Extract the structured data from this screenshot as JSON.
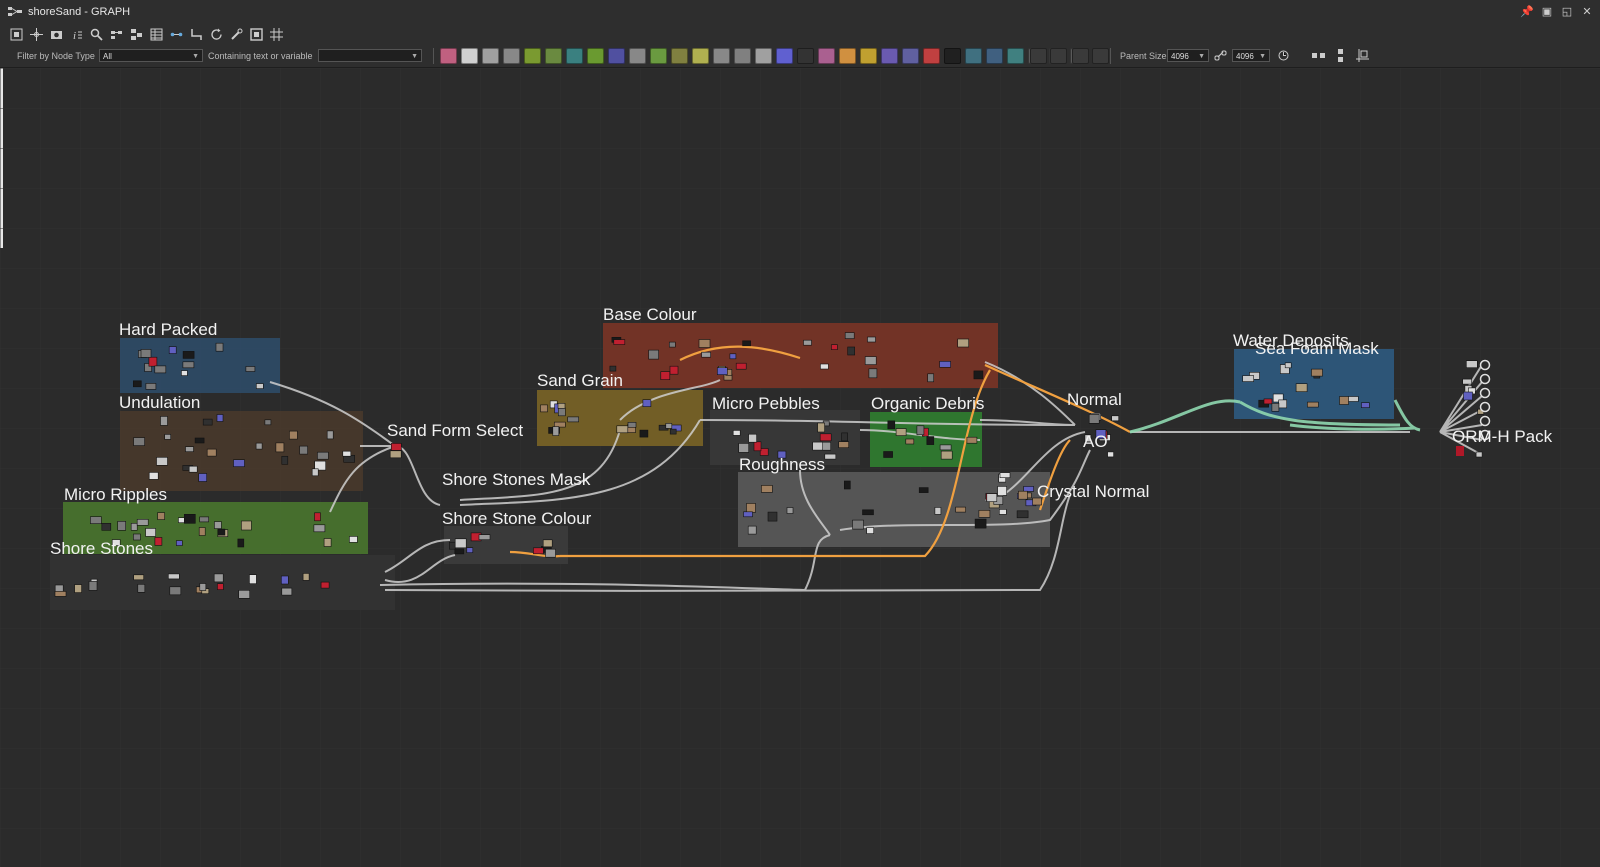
{
  "window": {
    "title": "shoreSand - GRAPH",
    "app_icon": "graph-icon"
  },
  "toolbar_top": {
    "icons": [
      "frame-all-icon",
      "center-view-icon",
      "screenshot-icon",
      "info-icon",
      "search-icon",
      "align-icon",
      "layout-icon",
      "table-icon",
      "link-icon",
      "connector-icon",
      "refresh-icon",
      "tools-icon",
      "preview-icon",
      "grid-icon"
    ]
  },
  "filter": {
    "node_type_label": "Filter by Node Type",
    "node_type_value": "All",
    "containing_label": "Containing text or variable",
    "containing_value": ""
  },
  "parent_size": {
    "label": "Parent Size:",
    "width": "4096",
    "height": "4096"
  },
  "accent_color": "#f0a040",
  "frames": [
    {
      "label": "Hard Packed",
      "color": "#2e4d6b"
    },
    {
      "label": "Undulation",
      "color": "#4a3a2c"
    },
    {
      "label": "Micro Ripples",
      "color": "#4b7a2e"
    },
    {
      "label": "Shore Stones",
      "color": "#333333"
    },
    {
      "label": "Sand Form Select",
      "color": ""
    },
    {
      "label": "Base Colour",
      "color": "#7a3426"
    },
    {
      "label": "Sand Grain",
      "color": "#7a6426"
    },
    {
      "label": "Micro Pebbles",
      "color": "#3a3a3a"
    },
    {
      "label": "Organic Debris",
      "color": "#2f7a2f"
    },
    {
      "label": "Roughness",
      "color": "#5a5a5a"
    },
    {
      "label": "Shore Stones Mask",
      "color": ""
    },
    {
      "label": "Shore Stone Colour",
      "color": "#3b3b3b"
    },
    {
      "label": "Normal",
      "color": ""
    },
    {
      "label": "AO",
      "color": ""
    },
    {
      "label": "Crystal Normal",
      "color": ""
    },
    {
      "label": "Water Deposits",
      "color": "#2e5a80"
    },
    {
      "label": "Sea Foam Mask",
      "color": "#2f6a8a"
    },
    {
      "label": "ORM-H Pack",
      "color": ""
    }
  ]
}
